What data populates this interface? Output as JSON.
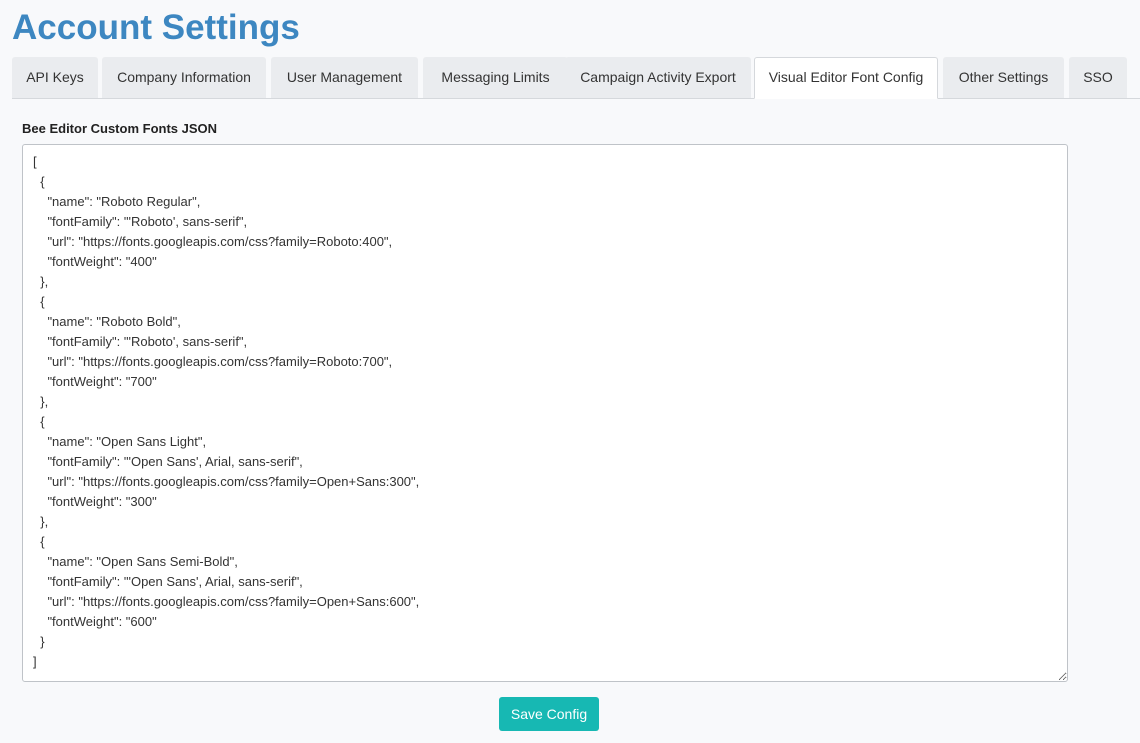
{
  "page": {
    "title": "Account Settings"
  },
  "tabs": [
    {
      "label": "API Keys",
      "active": false
    },
    {
      "label": "Company Information",
      "active": false
    },
    {
      "label": "User Management",
      "active": false
    },
    {
      "label": "Messaging Limits",
      "active": false
    },
    {
      "label": "Campaign Activity Export",
      "active": false
    },
    {
      "label": "Visual Editor Font Config",
      "active": true
    },
    {
      "label": "Other Settings",
      "active": false
    },
    {
      "label": "SSO",
      "active": false
    }
  ],
  "form": {
    "label": "Bee Editor Custom Fonts JSON",
    "value": "[\n  {\n    \"name\": \"Roboto Regular\",\n    \"fontFamily\": \"'Roboto', sans-serif\",\n    \"url\": \"https://fonts.googleapis.com/css?family=Roboto:400\",\n    \"fontWeight\": \"400\"\n  },\n  {\n    \"name\": \"Roboto Bold\",\n    \"fontFamily\": \"'Roboto', sans-serif\",\n    \"url\": \"https://fonts.googleapis.com/css?family=Roboto:700\",\n    \"fontWeight\": \"700\"\n  },\n  {\n    \"name\": \"Open Sans Light\",\n    \"fontFamily\": \"'Open Sans', Arial, sans-serif\",\n    \"url\": \"https://fonts.googleapis.com/css?family=Open+Sans:300\",\n    \"fontWeight\": \"300\"\n  },\n  {\n    \"name\": \"Open Sans Semi-Bold\",\n    \"fontFamily\": \"'Open Sans', Arial, sans-serif\",\n    \"url\": \"https://fonts.googleapis.com/css?family=Open+Sans:600\",\n    \"fontWeight\": \"600\"\n  }\n]",
    "save_label": "Save Config"
  },
  "colors": {
    "title": "#3d87c1",
    "save_button": "#17b8b3",
    "tab_inactive": "#eaecef",
    "tab_active": "#ffffff",
    "background": "#f8f9fb"
  }
}
